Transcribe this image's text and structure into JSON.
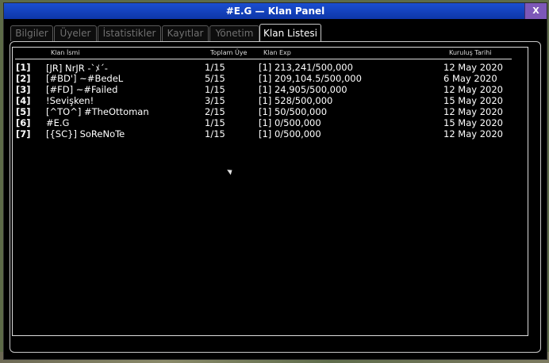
{
  "window": {
    "title": "#E.G — Klan Panel",
    "close_label": "X"
  },
  "tabs": [
    {
      "label": "Bilgiler",
      "active": false
    },
    {
      "label": "Üyeler",
      "active": false
    },
    {
      "label": "İstatistikler",
      "active": false
    },
    {
      "label": "Kayıtlar",
      "active": false
    },
    {
      "label": "Yönetim",
      "active": false
    },
    {
      "label": "Klan Listesi",
      "active": true
    }
  ],
  "table": {
    "columns": [
      "Klan İsmi",
      "Toplam Üye",
      "Klan Exp",
      "Kuruluş Tarihi"
    ],
    "rows": [
      {
        "idx": "[1]",
        "name": "[JR]  NrJR -`ﾒ´-",
        "members": "1/15",
        "exp": "[1] 213,241/500,000",
        "date": "12 May 2020"
      },
      {
        "idx": "[2]",
        "name": "[#BD']  ~#BedeL",
        "members": "5/15",
        "exp": "[1] 209,104.5/500,000",
        "date": "6 May 2020"
      },
      {
        "idx": "[3]",
        "name": "[#FD]  ~#Failed",
        "members": "1/15",
        "exp": "[1] 24,905/500,000",
        "date": "12 May 2020"
      },
      {
        "idx": "[4]",
        "name": "!Sevişken!",
        "members": "3/15",
        "exp": "[1] 528/500,000",
        "date": "15 May 2020"
      },
      {
        "idx": "[5]",
        "name": "[^TO^]  #TheOttoman",
        "members": "2/15",
        "exp": "[1] 50/500,000",
        "date": "12 May 2020"
      },
      {
        "idx": "[6]",
        "name": "#E.G",
        "members": "1/15",
        "exp": "[1] 0/500,000",
        "date": "15 May 2020"
      },
      {
        "idx": "[7]",
        "name": "[{SC}]  SoReNoTe",
        "members": "1/15",
        "exp": "[1] 0/500,000",
        "date": "12 May 2020"
      }
    ]
  }
}
